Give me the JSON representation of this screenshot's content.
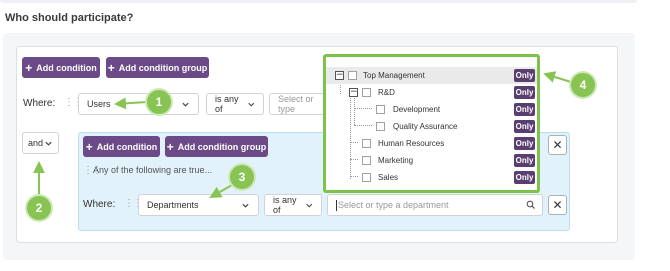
{
  "page": {
    "title": "Who should participate?"
  },
  "colors": {
    "accent_purple": "#6b4a87",
    "callout_green": "#88c454",
    "highlight_border": "#7dc24a",
    "group_bg": "#e1f2fb"
  },
  "top_group": {
    "add_condition": "Add condition",
    "add_condition_group": "Add condition group",
    "where_label": "Where:",
    "field_value": "Users",
    "operator_value": "is any of",
    "value_placeholder": "Select or type"
  },
  "conjunction": {
    "value": "and"
  },
  "nested_group": {
    "add_condition": "Add condition",
    "add_condition_group": "Add condition group",
    "description": "Any of the following are true...",
    "where_label": "Where:",
    "field_value": "Departments",
    "operator_value": "is any of",
    "value_placeholder": "Select or type a department"
  },
  "tree": {
    "only_label": "Only",
    "items": [
      {
        "label": "Top Management",
        "toggle": "−"
      },
      {
        "label": "R&D",
        "toggle": "−"
      },
      {
        "label": "Development"
      },
      {
        "label": "Quality Assurance"
      },
      {
        "label": "Human Resources"
      },
      {
        "label": "Marketing"
      },
      {
        "label": "Sales"
      }
    ]
  },
  "callouts": {
    "c1": "1",
    "c2": "2",
    "c3": "3",
    "c4": "4"
  },
  "icons": {
    "plus": "+",
    "close": "✕",
    "chevron": "chevron-down-icon",
    "search": "search-icon",
    "drag": "drag-handle-icon"
  }
}
